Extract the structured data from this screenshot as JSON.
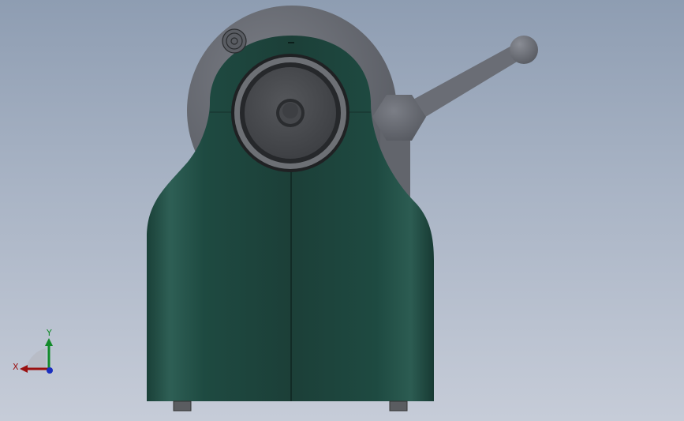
{
  "viewport": {
    "background_top": "#8e9db2",
    "background_bottom": "#c6ccd8"
  },
  "model": {
    "body_color": "#1e4a41",
    "cover_color": "#6a6d75",
    "handle_color": "#6a6d75",
    "feet_color": "#5a5c60"
  },
  "triad": {
    "x_label": "X",
    "y_label": "Y",
    "x_color": "#9a1010",
    "y_color": "#128a2a",
    "z_color": "#1a2fbf"
  }
}
